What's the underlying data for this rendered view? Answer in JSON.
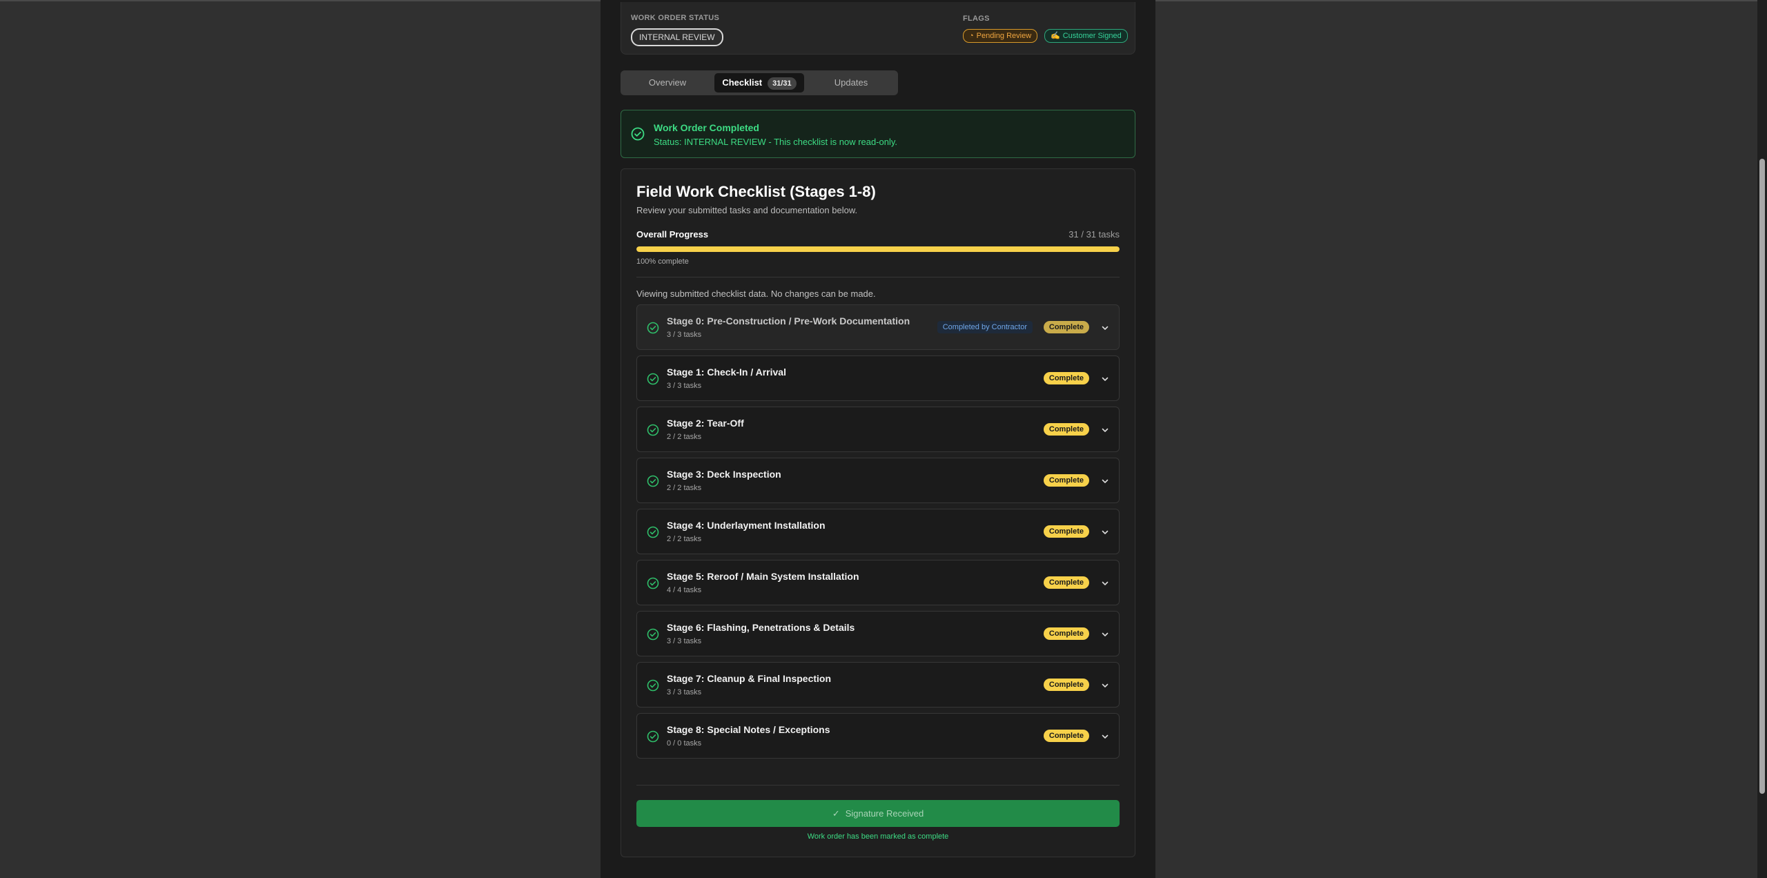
{
  "status": {
    "label": "WORK ORDER STATUS",
    "value": "INTERNAL REVIEW",
    "flags_label": "FLAGS",
    "flags": [
      {
        "icon": "clock-icon",
        "text": "Pending Review",
        "color": "#f0a640"
      },
      {
        "icon": "hand-writing-icon",
        "text": "Customer Signed",
        "color": "#36d29a"
      }
    ]
  },
  "tabs": {
    "overview": "Overview",
    "checklist": "Checklist",
    "checklist_count": "31/31",
    "updates": "Updates"
  },
  "alert": {
    "title": "Work Order Completed",
    "text": "Status: INTERNAL REVIEW - This checklist is now read-only."
  },
  "checklist": {
    "title": "Field Work Checklist (Stages 1-8)",
    "subtitle": "Review your submitted tasks and documentation below.",
    "progress_label": "Overall Progress",
    "progress_count": "31 / 31 tasks",
    "progress_fraction": 1.0,
    "progress_pct_text": "100% complete",
    "readonly_note": "Viewing submitted checklist data. No changes can be made.",
    "contractor_badge": "Completed by Contractor",
    "complete_label": "Complete",
    "stages": [
      {
        "title": "Stage 0: Pre-Construction / Pre-Work Documentation",
        "tasks": "3 / 3 tasks"
      },
      {
        "title": "Stage 1: Check-In / Arrival",
        "tasks": "3 / 3 tasks"
      },
      {
        "title": "Stage 2: Tear-Off",
        "tasks": "2 / 2 tasks"
      },
      {
        "title": "Stage 3: Deck Inspection",
        "tasks": "2 / 2 tasks"
      },
      {
        "title": "Stage 4: Underlayment Installation",
        "tasks": "2 / 2 tasks"
      },
      {
        "title": "Stage 5: Reroof / Main System Installation",
        "tasks": "4 / 4 tasks"
      },
      {
        "title": "Stage 6: Flashing, Penetrations & Details",
        "tasks": "3 / 3 tasks"
      },
      {
        "title": "Stage 7: Cleanup & Final Inspection",
        "tasks": "3 / 3 tasks"
      },
      {
        "title": "Stage 8: Special Notes / Exceptions",
        "tasks": "0 / 0 tasks"
      }
    ],
    "signature_button": "Signature Received",
    "signature_note": "Work order has been marked as complete"
  },
  "colors": {
    "accent_yellow": "#f7d14a",
    "success_green": "#3ddc84",
    "button_green": "#228b48"
  }
}
